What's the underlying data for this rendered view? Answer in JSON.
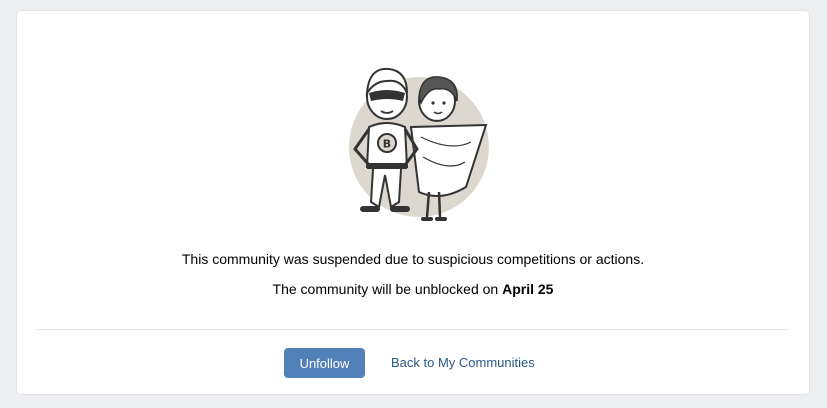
{
  "notice": {
    "line1": "This community was suspended due to suspicious competitions or actions.",
    "line2_prefix": "The community will be unblocked on ",
    "line2_date": "April 25"
  },
  "actions": {
    "unfollow_label": "Unfollow",
    "back_label": "Back to My Communities"
  },
  "illustration": {
    "icon": "superhero-couple-illustration",
    "badge_letter": "B"
  },
  "colors": {
    "background": "#edeef0",
    "card": "#ffffff",
    "primary_button": "#5181b8",
    "link": "#2a5885",
    "illustration_circle": "#dcd8cf"
  }
}
